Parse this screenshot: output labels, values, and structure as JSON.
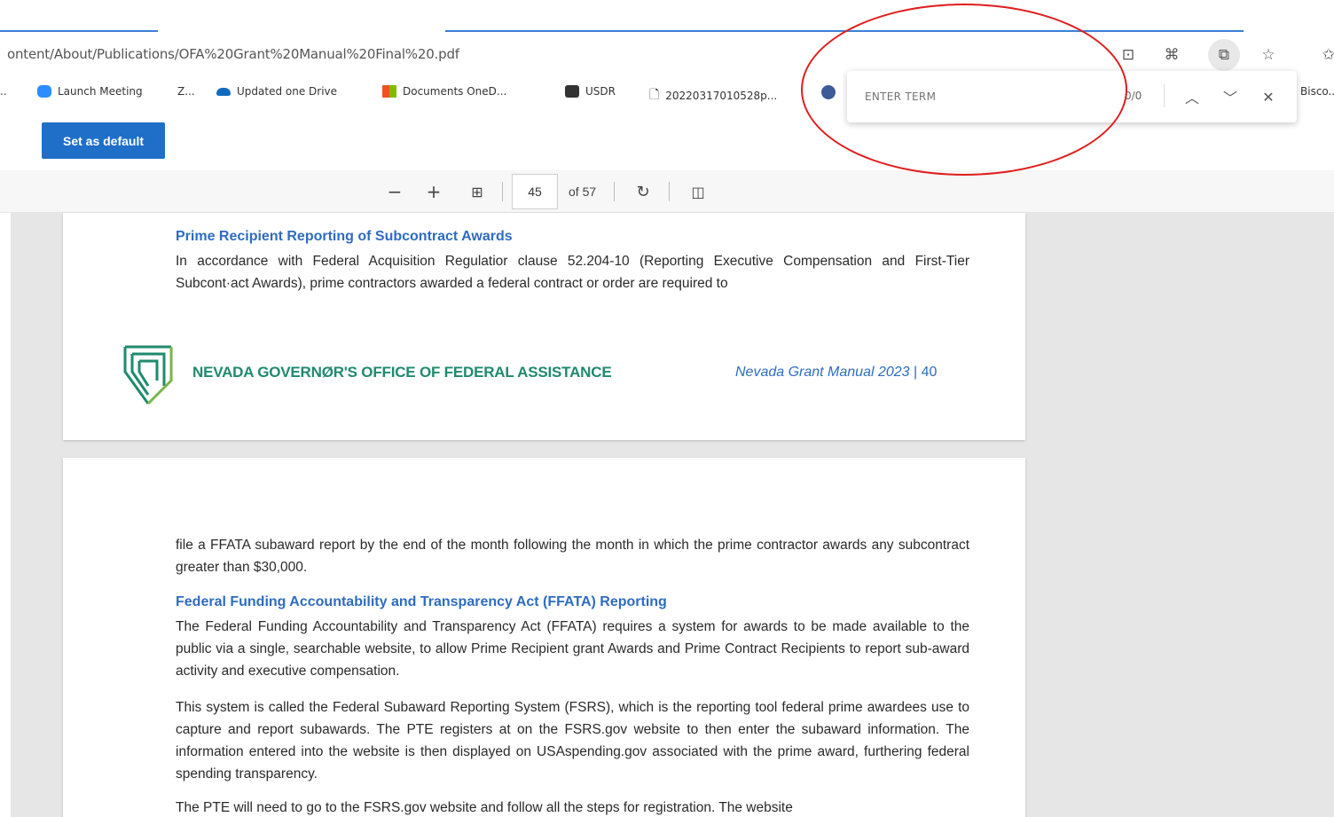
{
  "address_bar": {
    "url": "ontent/About/Publications/OFA%20Grant%20Manual%20Final%20.pdf",
    "icons": [
      "read-aloud-icon",
      "apps-icon",
      "collections-icon",
      "favorite-star-icon",
      "favorites-icon"
    ]
  },
  "favorites": [
    {
      "label": "Launch Meeting",
      "icon": "zoom-icon",
      "color": "#2d8cff"
    },
    {
      "label": "Z...",
      "icon": "",
      "color": ""
    },
    {
      "label": "Updated one Drive",
      "icon": "cloud-icon",
      "color": "#0f6cbd"
    },
    {
      "label": "Documents  OneD...",
      "icon": "microsoft-icon",
      "color": "#f25022"
    },
    {
      "label": "USDR",
      "icon": "usdr-icon",
      "color": "#333333"
    },
    {
      "label": "20220317010528p...",
      "icon": "document-icon",
      "color": "#555555"
    }
  ],
  "favorites_right_text": "Bisco...",
  "default_banner": {
    "button_label": "Set as default"
  },
  "pdf_toolbar": {
    "zoom_out": "−",
    "zoom_in": "+",
    "current_page": "45",
    "page_total": "of 57"
  },
  "find_bar": {
    "placeholder": "ENTER TERM",
    "count": "0/0"
  },
  "page_1": {
    "heading": "Prime Recipient Reporting of Subcontract Awards",
    "paragraph": "In accordance with Federal Acquisition Regulatior clause 52.204-10 (Reporting Executive Compensation and First-Tier Subcont·act Awards), prime contractors awarded a federal contract or order are required to",
    "footer_org": "NEVADA GOVERNØR'S OFFICE OF FEDERAL ASSISTANCE",
    "footer_manual": "Nevada Grant Manual 2023",
    "footer_page": "| 40"
  },
  "page_2": {
    "intro": "file a FFATA subaward report by the end of the month following the month in which the prime contractor awards any subcontract greater than $30,000.",
    "heading": "Federal Funding Accountability and Transparency Act (FFATA) Reporting",
    "para1": "The Federal Funding Accountability and Transparency Act (FFATA) requires a system for awards to be made available to the public via a single, searchable website, to allow Prime Recipient grant Awards and Prime Contract Recipients to report sub-award activity and executive compensation.",
    "para2": "This system is called the Federal Subaward Reporting System (FSRS), which is the reporting tool federal prime awardees use to capture and report subawards. The PTE registers at on the FSRS.gov website to then enter the subaward information. The information entered into the website is then displayed on USAspending.gov associated with the prime award, furthering federal spending transparency.",
    "para3": "The PTE will need to go to the FSRS.gov website and follow all the steps for registration. The website"
  },
  "colors": {
    "accent_blue": "#1f6fc9",
    "heading_blue": "#2e6cc0",
    "logo_green": "#1f8a6e",
    "annotation_red": "#e01d1d"
  }
}
